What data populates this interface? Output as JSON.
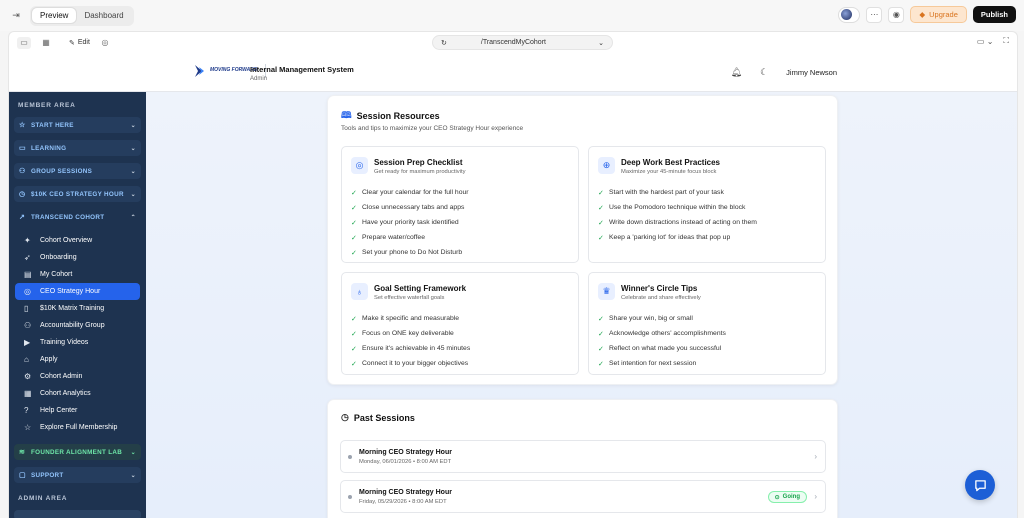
{
  "builder": {
    "tabs": [
      "Preview",
      "Dashboard"
    ],
    "edit_label": "Edit",
    "url_path": "/TranscendMyCohort",
    "upgrade_label": "Upgrade",
    "publish_label": "Publish"
  },
  "header": {
    "logo_text": "MOVING FORWARD",
    "system_title": "Internal Management System",
    "system_role": "Admin",
    "user_name": "Jimmy Newson"
  },
  "sidebar": {
    "member_heading": "MEMBER AREA",
    "groups": {
      "start_here": "START HERE",
      "learning": "LEARNING",
      "group_sessions": "GROUP SESSIONS",
      "ceo_hour": "$10K CEO STRATEGY HOUR",
      "transcend": "TRANSCEND COHORT",
      "founder_lab": "FOUNDER ALIGNMENT LAB",
      "support": "SUPPORT"
    },
    "items": [
      {
        "label": "Cohort Overview",
        "icon": "sparkle-icon"
      },
      {
        "label": "Onboarding",
        "icon": "rocket-icon"
      },
      {
        "label": "My Cohort",
        "icon": "calendar-icon"
      },
      {
        "label": "CEO Strategy Hour",
        "icon": "target-icon",
        "active": true
      },
      {
        "label": "$10K Matrix Training",
        "icon": "book-icon"
      },
      {
        "label": "Accountability Group",
        "icon": "users-icon"
      },
      {
        "label": "Training Videos",
        "icon": "video-icon"
      },
      {
        "label": "Apply",
        "icon": "graduation-cap-icon"
      },
      {
        "label": "Cohort Admin",
        "icon": "gear-icon"
      },
      {
        "label": "Cohort Analytics",
        "icon": "chart-icon"
      },
      {
        "label": "Help Center",
        "icon": "help-icon"
      },
      {
        "label": "Explore Full Membership",
        "icon": "star-icon"
      }
    ],
    "admin_heading": "ADMIN AREA"
  },
  "resources": {
    "title": "Session Resources",
    "subtitle": "Tools and tips to maximize your CEO Strategy Hour experience",
    "tiles": [
      {
        "title": "Session Prep Checklist",
        "subtitle": "Get ready for maximum productivity",
        "icon": "target-icon",
        "items": [
          "Clear your calendar for the full hour",
          "Close unnecessary tabs and apps",
          "Have your priority task identified",
          "Prepare water/coffee",
          "Set your phone to Do Not Disturb"
        ]
      },
      {
        "title": "Deep Work Best Practices",
        "subtitle": "Maximize your 45-minute focus block",
        "icon": "brain-icon",
        "items": [
          "Start with the hardest part of your task",
          "Use the Pomodoro technique within the block",
          "Write down distractions instead of acting on them",
          "Keep a 'parking lot' for ideas that pop up"
        ]
      },
      {
        "title": "Goal Setting Framework",
        "subtitle": "Set effective waterfall goals",
        "icon": "lightbulb-icon",
        "items": [
          "Make it specific and measurable",
          "Focus on ONE key deliverable",
          "Ensure it's achievable in 45 minutes",
          "Connect it to your bigger objectives"
        ]
      },
      {
        "title": "Winner's Circle Tips",
        "subtitle": "Celebrate and share effectively",
        "icon": "trophy-icon",
        "items": [
          "Share your win, big or small",
          "Acknowledge others' accomplishments",
          "Reflect on what made you successful",
          "Set intention for next session"
        ]
      }
    ]
  },
  "past_sessions": {
    "title": "Past Sessions",
    "sessions": [
      {
        "name": "Morning CEO Strategy Hour",
        "date": "Monday, 06/01/2026 • 8:00 AM EDT"
      },
      {
        "name": "Morning CEO Strategy Hour",
        "date": "Friday, 05/29/2026 • 8:00 AM EDT",
        "badge": "Going"
      }
    ]
  }
}
